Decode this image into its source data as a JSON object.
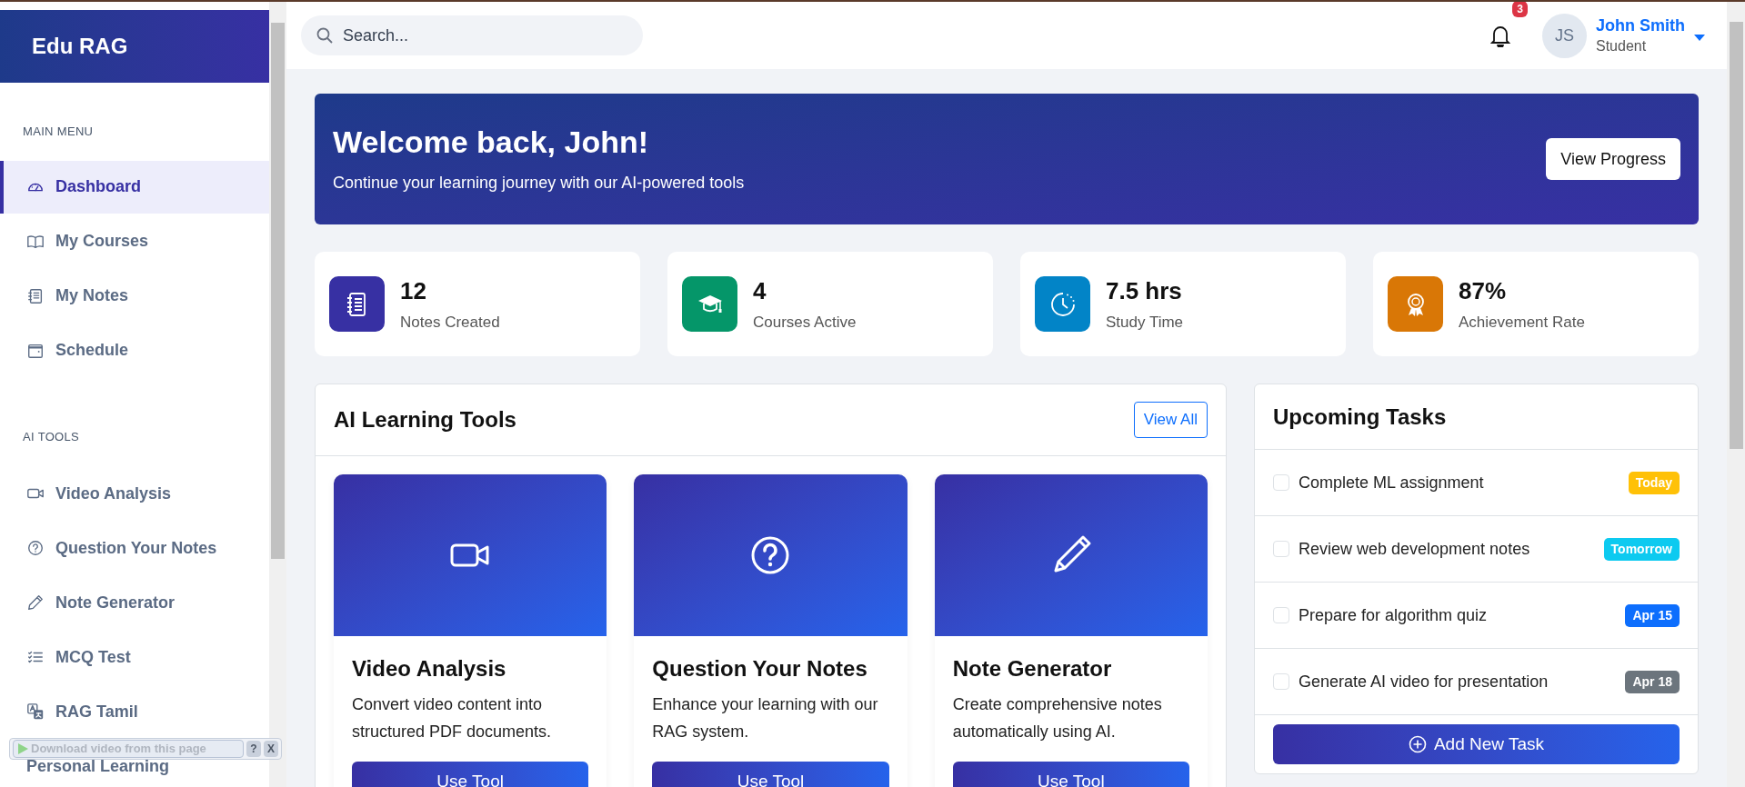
{
  "sidebar": {
    "brand": "Edu RAG",
    "sections": [
      {
        "title": "MAIN MENU",
        "items": [
          {
            "label": "Dashboard",
            "selected": true
          },
          {
            "label": "My Courses",
            "selected": false
          },
          {
            "label": "My Notes",
            "selected": false
          },
          {
            "label": "Schedule",
            "selected": false
          }
        ]
      },
      {
        "title": "AI TOOLS",
        "items": [
          {
            "label": "Video Analysis",
            "selected": false
          },
          {
            "label": "Question Your Notes",
            "selected": false
          },
          {
            "label": "Note Generator",
            "selected": false
          },
          {
            "label": "MCQ Test",
            "selected": false
          },
          {
            "label": "RAG Tamil",
            "selected": false
          },
          {
            "label": "Personal Learning",
            "selected": false
          }
        ]
      }
    ]
  },
  "topbar": {
    "search": {
      "placeholder": "Search..."
    },
    "notifications": "3",
    "user": {
      "initials": "JS",
      "name": "John Smith",
      "role": "Student"
    }
  },
  "welcome": {
    "title": "Welcome back, John!",
    "subtitle": "Continue your learning journey with our AI-powered tools",
    "button": "View Progress"
  },
  "stats": [
    {
      "value": "12",
      "label": "Notes Created",
      "color": "#3730a3"
    },
    {
      "value": "4",
      "label": "Courses Active",
      "color": "#059669"
    },
    {
      "value": "7.5 hrs",
      "label": "Study Time",
      "color": "#0284c7"
    },
    {
      "value": "87%",
      "label": "Achievement Rate",
      "color": "#d97706"
    }
  ],
  "tools": {
    "title": "AI Learning Tools",
    "view_all": "View All",
    "cards": [
      {
        "title": "Video Analysis",
        "description": "Convert video content into structured PDF documents.",
        "button": "Use Tool"
      },
      {
        "title": "Question Your Notes",
        "description": "Enhance your learning with our RAG system.",
        "button": "Use Tool"
      },
      {
        "title": "Note Generator",
        "description": "Create comprehensive notes automatically using AI.",
        "button": "Use Tool"
      }
    ]
  },
  "tasks": {
    "title": "Upcoming Tasks",
    "items": [
      {
        "text": "Complete ML assignment",
        "checked": false,
        "due": "Today",
        "color": "#ffc107"
      },
      {
        "text": "Review web development notes",
        "checked": false,
        "due": "Tomorrow",
        "color": "#0dcaf0"
      },
      {
        "text": "Prepare for algorithm quiz",
        "checked": false,
        "due": "Apr 15",
        "color": "#0d6efd"
      },
      {
        "text": "Generate AI video for presentation",
        "checked": false,
        "due": "Apr 18",
        "color": "#6c757d"
      }
    ],
    "add_button": "Add New Task"
  },
  "overlay": {
    "text": "Download video from this page",
    "help": "?",
    "close": "X"
  }
}
